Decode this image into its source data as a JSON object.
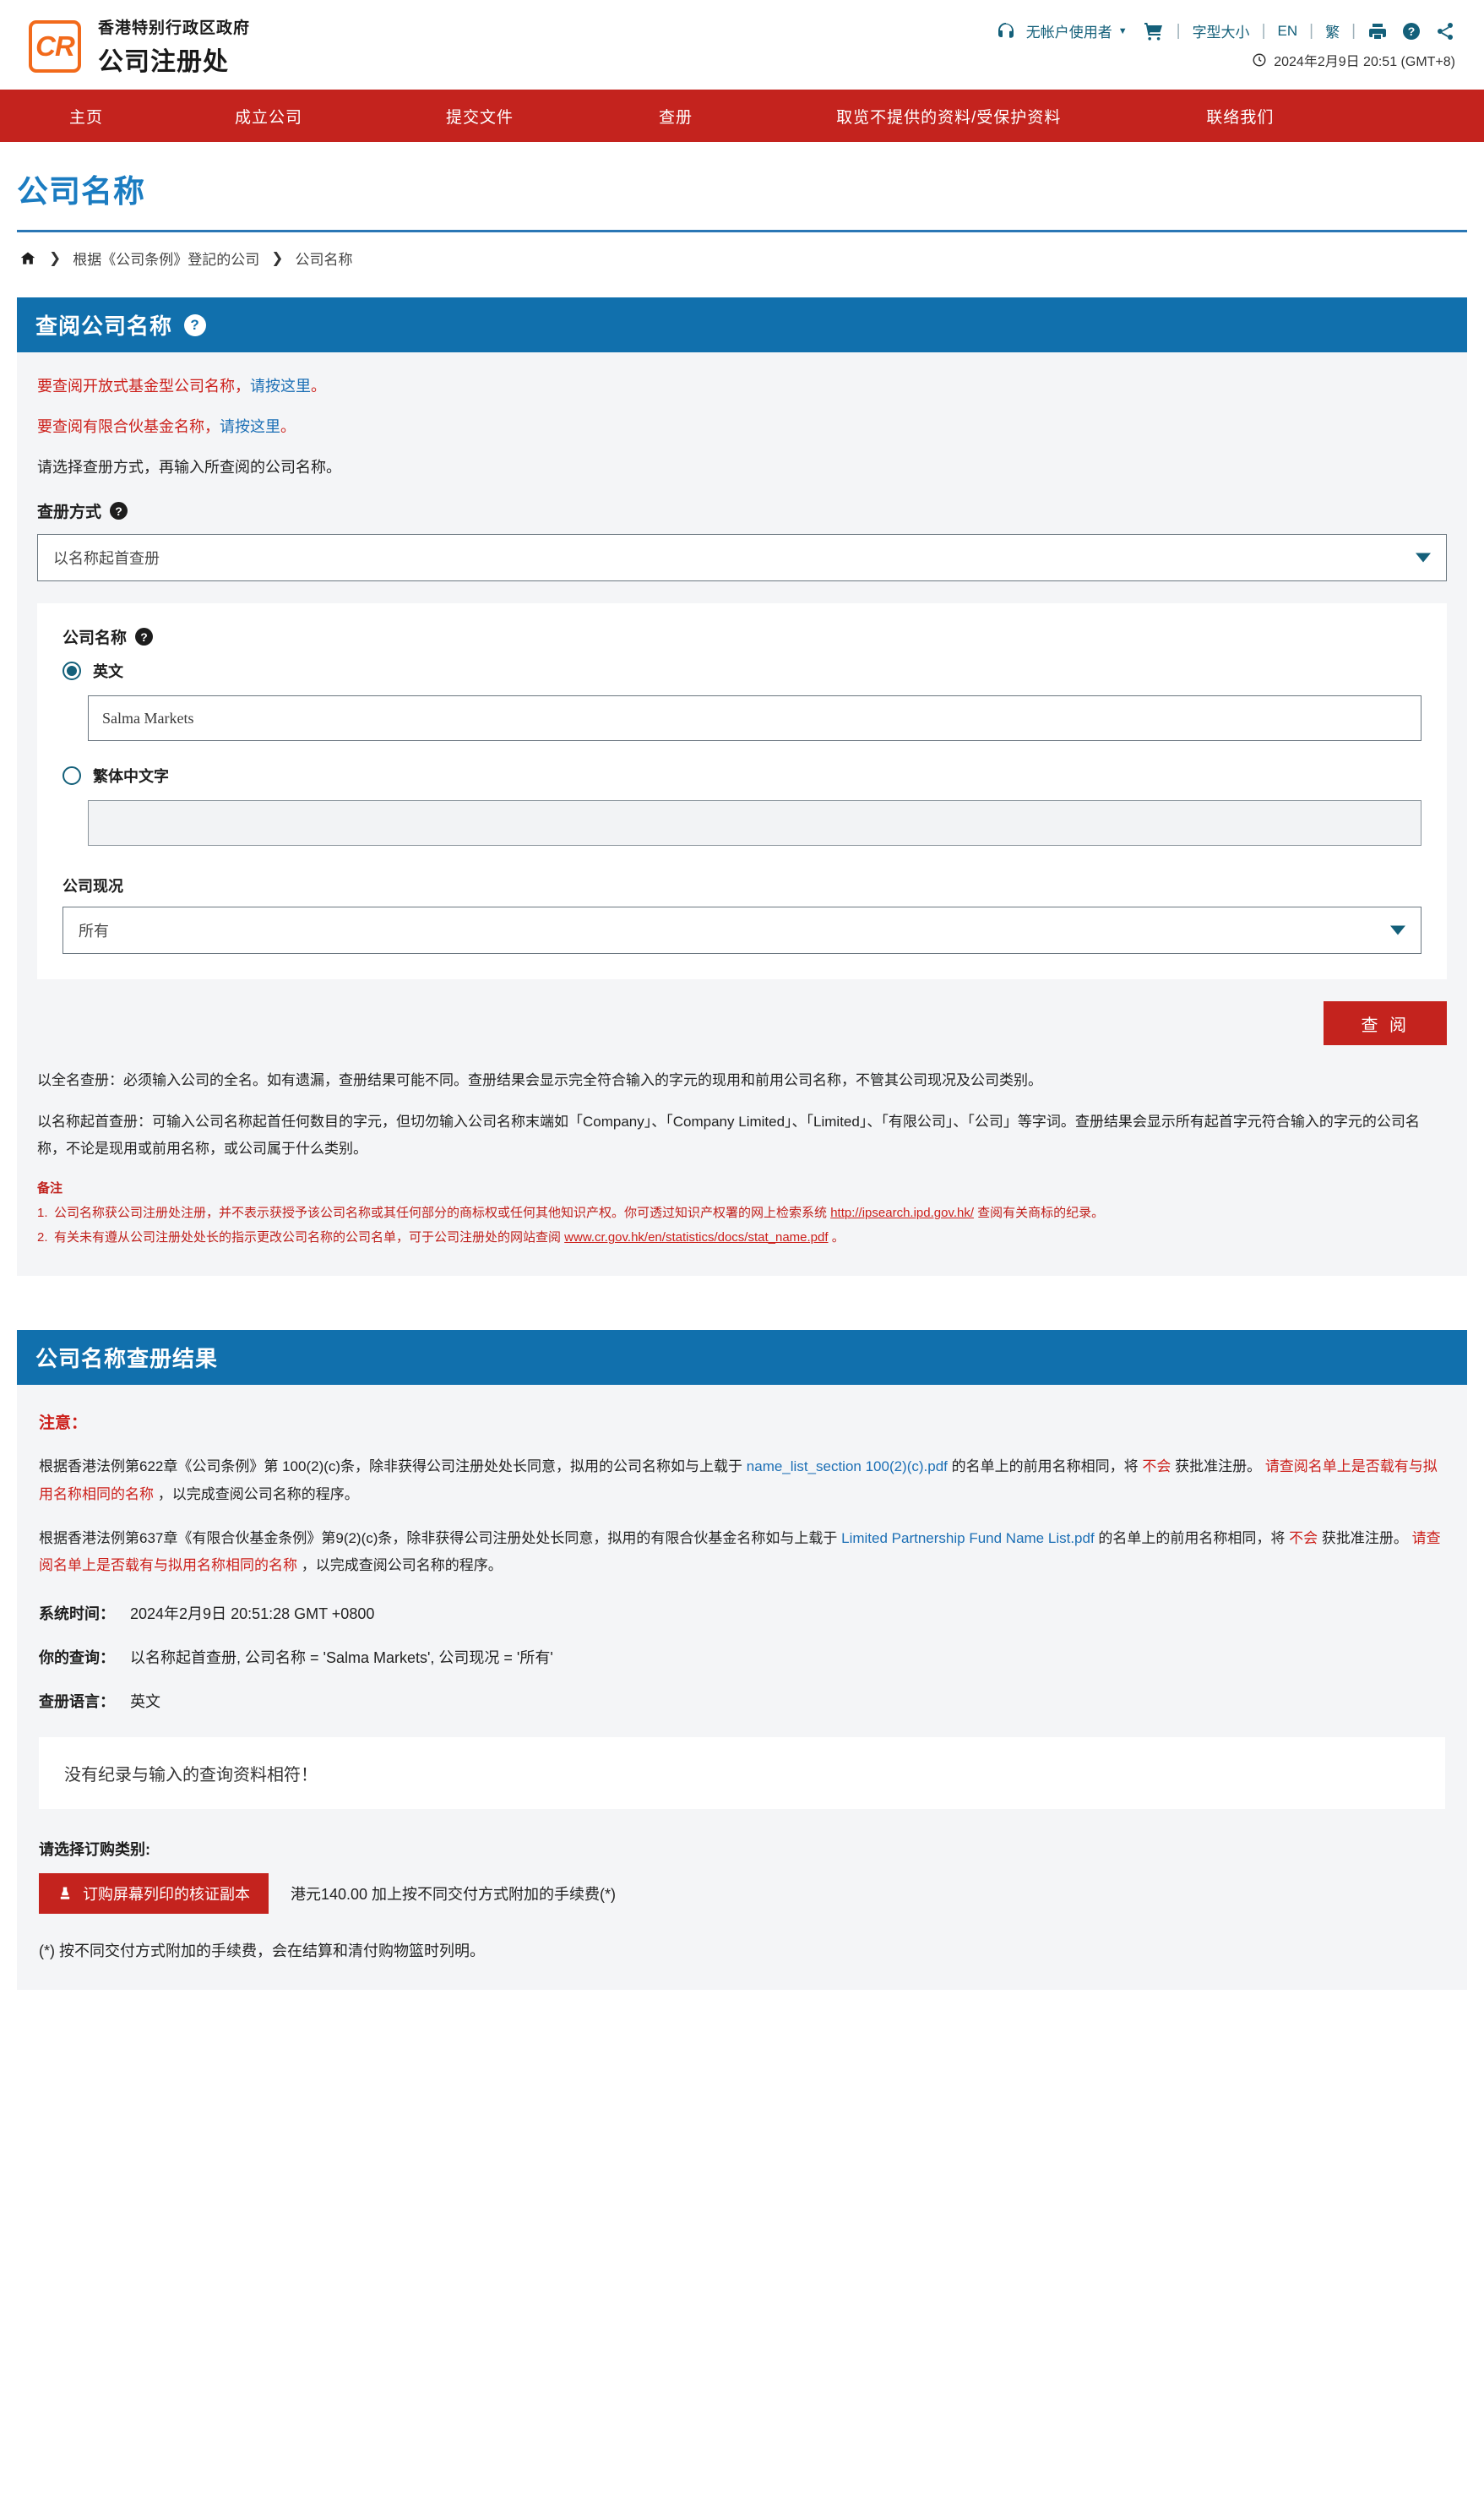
{
  "header": {
    "logo_text": "CR",
    "org_line1": "香港特别行政区政府",
    "org_line2": "公司注册处",
    "utils": {
      "user_label": "无帐户使用者",
      "font_size_label": "字型大小",
      "lang_en": "EN",
      "lang_tc": "繁",
      "headset_icon": "headset-icon",
      "cart_icon": "shopping-cart-icon",
      "print_icon": "printer-icon",
      "help_icon": "help-circle-icon",
      "share_icon": "share-icon",
      "clock_icon": "clock-icon"
    },
    "datetime": "2024年2月9日 20:51 (GMT+8)"
  },
  "nav": {
    "items": [
      {
        "label": "主页"
      },
      {
        "label": "成立公司"
      },
      {
        "label": "提交文件"
      },
      {
        "label": "查册"
      },
      {
        "label": "取览不提供的资料/受保护资料"
      },
      {
        "label": "联络我们"
      }
    ]
  },
  "page": {
    "title": "公司名称",
    "breadcrumb": [
      {
        "label": "home-icon"
      },
      {
        "label": "根据《公司条例》登記的公司"
      },
      {
        "label": "公司名称"
      }
    ]
  },
  "search_panel": {
    "heading": "查阅公司名称",
    "notice_ofc_prefix": "要查阅开放式基金型公司名称，",
    "notice_ofc_link": "请按这里",
    "notice_ofc_suffix": "。",
    "notice_lpf_prefix": "要查阅有限合伙基金名称，",
    "notice_lpf_link": "请按这里",
    "notice_lpf_suffix": "。",
    "intro": "请选择查册方式，再输入所查阅的公司名称。",
    "search_mode_label": "查册方式",
    "search_mode_value": "以名称起首查册",
    "company_name_label": "公司名称",
    "radio_english": "英文",
    "radio_tc": "繁体中文字",
    "english_value": "Salma Markets",
    "tc_value": "",
    "status_label": "公司现况",
    "status_value": "所有",
    "search_button": "查 阅",
    "explain_full": "以全名查册：必须输入公司的全名。如有遗漏，查册结果可能不同。查册结果会显示完全符合输入的字元的现用和前用公司名称，不管其公司现况及公司类别。",
    "explain_prefix": "以名称起首查册：可输入公司名称起首任何数目的字元，但切勿输入公司名称末端如「Company」、「Company Limited」、「Limited」、「有限公司」、「公司」等字词。查册结果会显示所有起首字元符合输入的字元的公司名称，不论是现用或前用名称，或公司属于什么类别。",
    "remarks_title": "备注",
    "remark_1_pre": "公司名称获公司注册处注册，并不表示获授予该公司名称或其任何部分的商标权或任何其他知识产权。你可透过知识产权署的网上检索系统 ",
    "remark_1_link": "http://ipsearch.ipd.gov.hk/",
    "remark_1_post": " 查阅有关商标的纪录。",
    "remark_2_pre": "有关未有遵从公司注册处处长的指示更改公司名称的公司名单，可于公司注册处的网站查阅 ",
    "remark_2_link": "www.cr.gov.hk/en/statistics/docs/stat_name.pdf",
    "remark_2_post": " 。"
  },
  "results_panel": {
    "heading": "公司名称查册结果",
    "attention": "注意：",
    "para1_a": "根据香港法例第622章《公司条例》第 100(2)(c)条，除非获得公司注册处处长同意，拟用的公司名称如与上载于 ",
    "para1_link": "name_list_section 100(2)(c).pdf",
    "para1_b": " 的名单上的前用名称相同，将 ",
    "para1_red1": "不会",
    "para1_c": " 获批准注册。 ",
    "para1_red2": "请查阅名单上是否载有与拟用名称相同的名称",
    "para1_d": " ，以完成查阅公司名称的程序。",
    "para2_a": "根据香港法例第637章《有限合伙基金条例》第9(2)(c)条，除非获得公司注册处处长同意，拟用的有限合伙基金名称如与上载于 ",
    "para2_link": "Limited Partnership Fund Name List.pdf",
    "para2_b": " 的名单上的前用名称相同，将 ",
    "para2_red1": "不会",
    "para2_c": " 获批准注册。 ",
    "para2_red2": "请查阅名单上是否载有与拟用名称相同的名称",
    "para2_d": " ，以完成查阅公司名称的程序。",
    "system_time_label": "系统时间：",
    "system_time_value": "2024年2月9日 20:51:28 GMT +0800",
    "query_label": "你的查询：",
    "query_value": "以名称起首查册, 公司名称 = 'Salma Markets', 公司现况 = '所有'",
    "language_label": "查册语言：",
    "language_value": "英文",
    "empty_message": "没有纪录与输入的查询资料相符！",
    "order_title": "请选择订购类别:",
    "order_button": "订购屏幕列印的核证副本",
    "order_icon": "stamp-icon",
    "order_price": "港元140.00 加上按不同交付方式附加的手续费(*)",
    "fee_note": "(*) 按不同交付方式附加的手续费，会在结算和清付购物篮时列明。"
  },
  "colors": {
    "brand_orange": "#f26a1b",
    "nav_red": "#c4231e",
    "panel_blue": "#1170ad",
    "title_blue": "#1b7cc1",
    "teal": "#14607a",
    "link_red": "#cc1f1a"
  }
}
